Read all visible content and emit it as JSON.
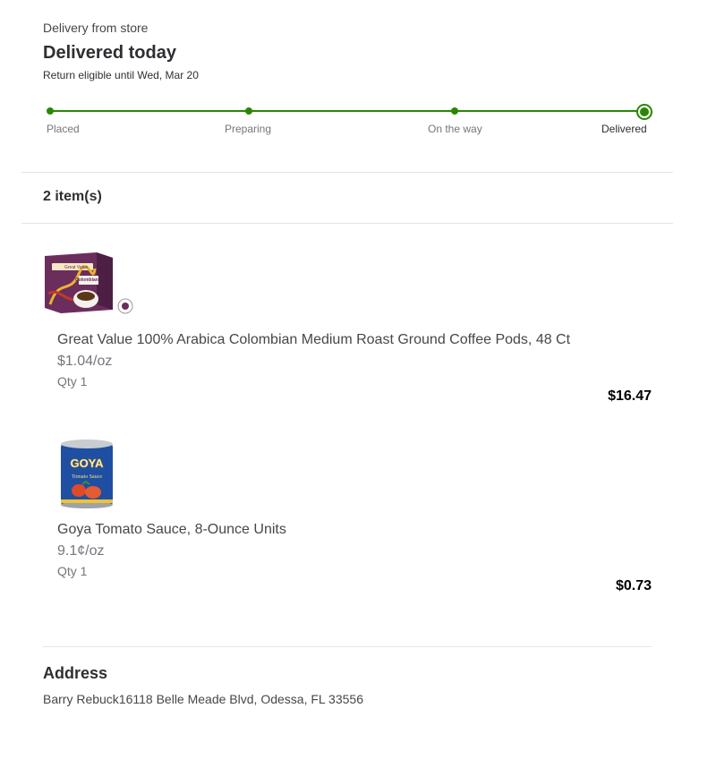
{
  "order": {
    "delivery_source": "Delivery from store",
    "status_title": "Delivered today",
    "return_note": "Return eligible until Wed, Mar 20"
  },
  "tracker": {
    "steps": [
      {
        "label": "Placed",
        "completed": true
      },
      {
        "label": "Preparing",
        "completed": true
      },
      {
        "label": "On the way",
        "completed": true
      },
      {
        "label": "Delivered",
        "completed": true,
        "current": true
      }
    ],
    "accent_color": "#2a8703"
  },
  "items_section": {
    "count_label": "2 item(s)"
  },
  "items": [
    {
      "name": "Great Value 100% Arabica Colombian Medium Roast Ground Coffee Pods, 48 Ct",
      "unit_price": "$1.04/oz",
      "qty": "Qty 1",
      "price": "$16.47",
      "image_icon": "coffee-pods-box-image",
      "image_text": {
        "brand": "Great Value",
        "product": "Colombian"
      }
    },
    {
      "name": "Goya Tomato Sauce, 8-Ounce Units",
      "unit_price": "9.1¢/oz",
      "qty": "Qty 1",
      "price": "$0.73",
      "image_icon": "tomato-sauce-can-image",
      "image_text": {
        "brand": "GOYA",
        "product": "Tomato Sauce"
      }
    }
  ],
  "address": {
    "heading": "Address",
    "text": "Barry Rebuck16118 Belle Meade Blvd, Odessa, FL 33556"
  }
}
